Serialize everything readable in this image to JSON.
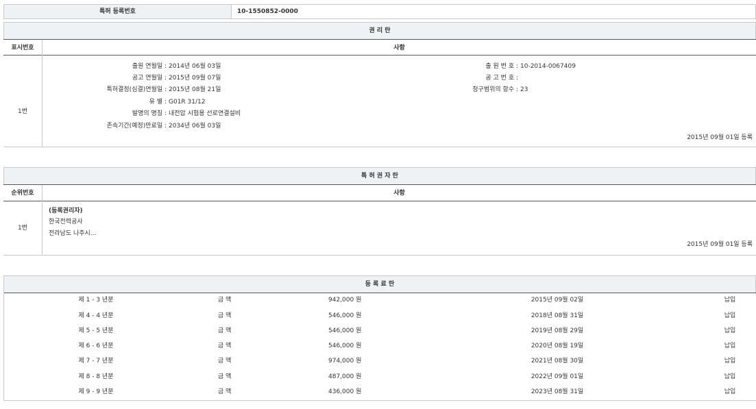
{
  "top": {
    "label": "특허 등록번호",
    "value": "10-1550852-0000"
  },
  "rights": {
    "title": "권 리 란",
    "col_num": "표시번호",
    "col_detail": "사항",
    "row_num": "1번",
    "left": [
      {
        "label": "출원 연월일 :",
        "value": "2014년 06월 03일"
      },
      {
        "label": "공고 연월일 :",
        "value": "2015년 09월 07일"
      },
      {
        "label": "특허결정(심결)연월일 :",
        "value": "2015년 08월 21일"
      },
      {
        "label": "유 별 :",
        "value": "G01R 31/12"
      },
      {
        "label": "발명의 명칭 :",
        "value": "내전압 시험용 선로연결설비"
      },
      {
        "label": "존속기간(예정)만료일 :",
        "value": "2034년 06월 03일"
      }
    ],
    "right": [
      {
        "label": "출 원 번 호 :",
        "value": "10-2014-0067409"
      },
      {
        "label": "공 고 번 호 :",
        "value": ""
      },
      {
        "label": "청구범위의 항수 :",
        "value": "23"
      }
    ],
    "reg_date": "2015년 09월 01일 등록"
  },
  "owners": {
    "title": "특 허 권 자 란",
    "col_num": "순위번호",
    "col_detail": "사항",
    "row_num": "1번",
    "owner_type": "(등록권리자)",
    "owner_name": "한국전력공사",
    "owner_addr": "전라남도 나주시...",
    "reg_date": "2015년 09월 01일 등록"
  },
  "fees": {
    "title": "등 록 료 란",
    "rows": [
      {
        "period": "제 1 - 3 년분",
        "label": "금 액",
        "amount": "942,000 원",
        "date": "2015년 09월 02일",
        "status": "납입"
      },
      {
        "period": "제 4 - 4 년분",
        "label": "금 액",
        "amount": "546,000 원",
        "date": "2018년 08월 31일",
        "status": "납입"
      },
      {
        "period": "제 5 - 5 년분",
        "label": "금 액",
        "amount": "546,000 원",
        "date": "2019년 08월 29일",
        "status": "납입"
      },
      {
        "period": "제 6 - 6 년분",
        "label": "금 액",
        "amount": "546,000 원",
        "date": "2020년 08월 19일",
        "status": "납입"
      },
      {
        "period": "제 7 - 7 년분",
        "label": "금 액",
        "amount": "974,000 원",
        "date": "2021년 08월 30일",
        "status": "납입"
      },
      {
        "period": "제 8 - 8 년분",
        "label": "금 액",
        "amount": "487,000 원",
        "date": "2022년 09월 01일",
        "status": "납입"
      },
      {
        "period": "제 9 - 9 년분",
        "label": "금 액",
        "amount": "436,000 원",
        "date": "2023년 08월 31일",
        "status": "납입"
      }
    ]
  }
}
